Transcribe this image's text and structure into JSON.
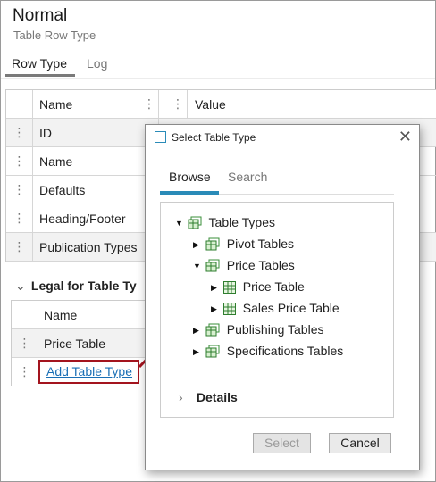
{
  "page": {
    "title": "Normal",
    "subtitle": "Table Row Type"
  },
  "tabs": [
    {
      "label": "Row Type",
      "active": true
    },
    {
      "label": "Log",
      "active": false
    }
  ],
  "grid": {
    "columns": [
      "Name",
      "Value"
    ],
    "rows": [
      "ID",
      "Name",
      "Defaults",
      "Heading/Footer",
      "Publication Types"
    ]
  },
  "legal": {
    "title": "Legal for Table Ty",
    "column": "Name",
    "rows": [
      "Price Table"
    ],
    "add_link": "Add Table Type"
  },
  "dialog": {
    "title": "Select Table Type",
    "tabs": [
      {
        "label": "Browse",
        "active": true
      },
      {
        "label": "Search",
        "active": false
      }
    ],
    "tree": [
      {
        "label": "Table Types",
        "expanded": true
      },
      {
        "label": "Pivot Tables",
        "expanded": false
      },
      {
        "label": "Price Tables",
        "expanded": true
      },
      {
        "label": "Price Table",
        "expanded": false
      },
      {
        "label": "Sales Price Table",
        "expanded": false
      },
      {
        "label": "Publishing Tables",
        "expanded": false
      },
      {
        "label": "Specifications Tables",
        "expanded": false
      }
    ],
    "details_label": "Details",
    "select_label": "Select",
    "cancel_label": "Cancel"
  },
  "colors": {
    "accent": "#2a8bb8",
    "highlight": "#a3141e",
    "link": "#1a6fb5"
  },
  "icons": [
    "grip-icon",
    "chevron-down-icon",
    "chevron-right-icon",
    "close-icon",
    "folder-table-icon",
    "table-icon",
    "expand-triangle-icon",
    "collapse-triangle-icon"
  ]
}
